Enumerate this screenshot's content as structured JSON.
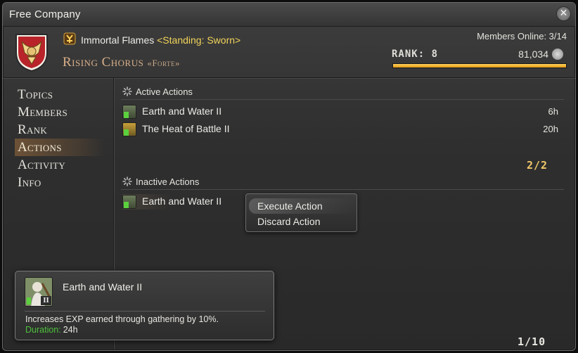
{
  "window": {
    "title": "Free Company"
  },
  "header": {
    "grand_company": "Immortal Flames",
    "standing": "<Standing: Sworn>",
    "fc_name": "Rising Chorus",
    "fc_tag": "«Forte»",
    "members_online": "Members Online: 3/14",
    "rank_label": "RANK: 8",
    "points": "81,034",
    "rank_progress": 1.0
  },
  "nav": {
    "items": [
      {
        "label": "Topics"
      },
      {
        "label": "Members"
      },
      {
        "label": "Rank"
      },
      {
        "label": "Actions",
        "selected": true
      },
      {
        "label": "Activity"
      },
      {
        "label": "Info"
      }
    ]
  },
  "active_actions": {
    "heading": "Active Actions",
    "items": [
      {
        "name": "Earth and Water II",
        "time": "6h"
      },
      {
        "name": "The Heat of Battle II",
        "time": "20h"
      }
    ],
    "count": "2/2"
  },
  "inactive_actions": {
    "heading": "Inactive Actions",
    "items": [
      {
        "name": "Earth and Water II"
      }
    ]
  },
  "context_menu": {
    "items": [
      {
        "label": "Execute Action"
      },
      {
        "label": "Discard Action"
      }
    ]
  },
  "tooltip": {
    "name": "Earth and Water II",
    "badge": "II",
    "description": "Increases EXP earned through gathering by 10%.",
    "duration_label": "Duration:",
    "duration_value": "24h"
  },
  "inactive_count": "1/10",
  "colors": {
    "standing": "#f2d45a",
    "fc_name": "#d9b08a",
    "count": "#f2c86a",
    "duration_label": "#4cc23a",
    "rank_bar": "#f0b030"
  }
}
